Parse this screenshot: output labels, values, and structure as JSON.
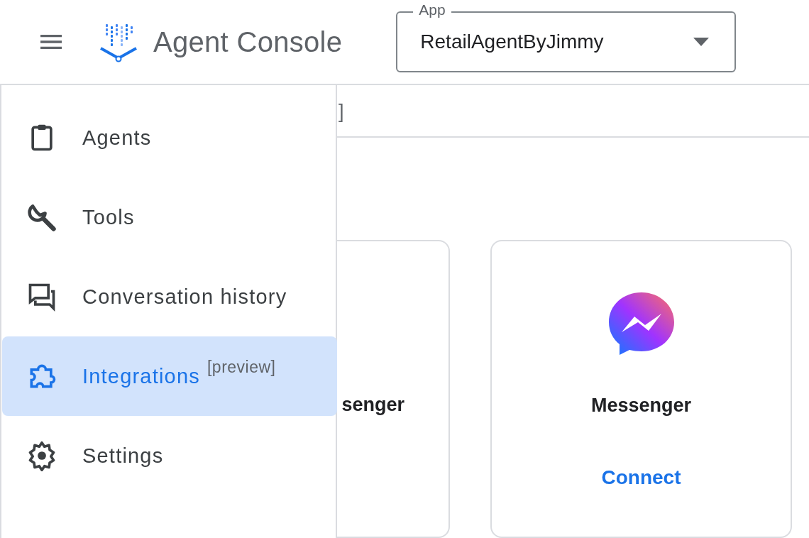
{
  "header": {
    "title": "Agent Console",
    "app_select": {
      "label": "App",
      "value": "RetailAgentByJimmy"
    }
  },
  "nav": {
    "items": [
      {
        "label": "Agents",
        "selected": false
      },
      {
        "label": "Tools",
        "selected": false
      },
      {
        "label": "Conversation history",
        "selected": false
      },
      {
        "label": "Integrations",
        "badge": "[preview]",
        "selected": true
      },
      {
        "label": "Settings",
        "selected": false
      }
    ]
  },
  "content": {
    "tab_fragment": "]",
    "cards": [
      {
        "kind": "partial",
        "title": "senger"
      },
      {
        "kind": "full",
        "title": "Messenger",
        "action": "Connect"
      }
    ]
  }
}
